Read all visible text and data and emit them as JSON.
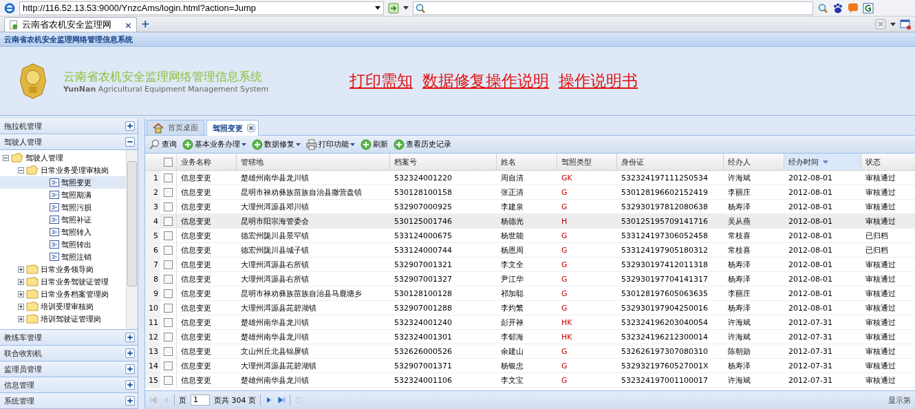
{
  "browser": {
    "address": "http://116.52.13.53:9000/YnzcAms/login.html?action=Jump",
    "tab": {
      "title": "云南省农机安全监理网",
      "close": "×"
    },
    "new_tab": "+"
  },
  "system_bar": {
    "title": "云南省农机安全监理网络管理信息系统"
  },
  "header": {
    "title": "云南省农机安全监理网络管理信息系统",
    "subtitle_bold": "YunNan",
    "subtitle": "Agricultural Equipment Management System",
    "links": [
      "打印需知",
      "数据修复操作说明",
      "操作说明书"
    ]
  },
  "sidebar": {
    "sections": [
      {
        "label": "拖拉机管理",
        "expanded": false
      },
      {
        "label": "驾驶人管理",
        "expanded": true,
        "tree": [
          {
            "label": "驾驶人管理",
            "expanded": true,
            "children": [
              {
                "label": "日常业务受理审核岗",
                "expanded": true,
                "children": [
                  {
                    "label": "驾照变更",
                    "selected": true
                  },
                  {
                    "label": "驾照期满",
                    "selected": false
                  },
                  {
                    "label": "驾照污损",
                    "selected": false
                  },
                  {
                    "label": "驾照补证",
                    "selected": false
                  },
                  {
                    "label": "驾照转入",
                    "selected": false
                  },
                  {
                    "label": "驾照转出",
                    "selected": false
                  },
                  {
                    "label": "驾照注销",
                    "selected": false
                  }
                ]
              },
              {
                "label": "日常业务领导岗",
                "expanded": false
              },
              {
                "label": "日常业务驾驶证管理",
                "expanded": false
              },
              {
                "label": "日常业务档案管理岗",
                "expanded": false
              },
              {
                "label": "培训受理审核岗",
                "expanded": false
              },
              {
                "label": "培训驾驶证管理岗",
                "expanded": false
              }
            ]
          }
        ]
      },
      {
        "label": "教练车管理",
        "expanded": false
      },
      {
        "label": "联合收割机",
        "expanded": false
      },
      {
        "label": "监理员管理",
        "expanded": false
      },
      {
        "label": "信息管理",
        "expanded": false
      },
      {
        "label": "系统管理",
        "expanded": false
      }
    ]
  },
  "tabs": [
    {
      "label": "首页桌面",
      "selected": false,
      "kind": "home"
    },
    {
      "label": "驾照变更",
      "selected": true,
      "kind": "closable"
    }
  ],
  "toolbar": [
    {
      "label": "查询",
      "kind": "search",
      "menu": false
    },
    {
      "label": "基本业务办理",
      "kind": "add",
      "menu": true
    },
    {
      "label": "数据修复",
      "kind": "add",
      "menu": true
    },
    {
      "label": "打印功能",
      "kind": "print",
      "menu": true
    },
    {
      "label": "刷新",
      "kind": "add",
      "menu": false
    },
    {
      "label": "查看历史记录",
      "kind": "add",
      "menu": false
    }
  ],
  "table": {
    "select_all": false,
    "columns": [
      {
        "label": "业务名称",
        "sorted": false
      },
      {
        "label": "管辖地",
        "sorted": false
      },
      {
        "label": "档案号",
        "sorted": false
      },
      {
        "label": "姓名",
        "sorted": false
      },
      {
        "label": "驾照类型",
        "sorted": false
      },
      {
        "label": "身份证",
        "sorted": false
      },
      {
        "label": "经办人",
        "sorted": false
      },
      {
        "label": "经办时间",
        "sorted": true
      },
      {
        "label": "状态",
        "sorted": false
      }
    ],
    "rows": [
      {
        "num": "1",
        "checked": false,
        "selected": false,
        "cells": [
          "信息变更",
          "楚雄州南华县龙川镇",
          "532324001220",
          "周自清",
          "GK",
          "532324197111250534",
          "许海斌",
          "2012-08-01",
          "审核通过"
        ]
      },
      {
        "num": "2",
        "checked": false,
        "selected": false,
        "cells": [
          "信息变更",
          "昆明市禄劝彝族苗族自治县撒营盘镇",
          "530128100158",
          "张正清",
          "G",
          "530128196602152419",
          "李丽庄",
          "2012-08-01",
          "审核通过"
        ]
      },
      {
        "num": "3",
        "checked": false,
        "selected": false,
        "cells": [
          "信息变更",
          "大理州洱源县邓川镇",
          "532907000925",
          "李建泉",
          "G",
          "532930197812080638",
          "杨寿泽",
          "2012-08-01",
          "审核通过"
        ]
      },
      {
        "num": "4",
        "checked": false,
        "selected": true,
        "cells": [
          "信息变更",
          "昆明市阳宗海管委会",
          "530125001746",
          "杨德光",
          "H",
          "530125195709141716",
          "吴从燕",
          "2012-08-01",
          "审核通过"
        ]
      },
      {
        "num": "5",
        "checked": false,
        "selected": false,
        "cells": [
          "信息变更",
          "德宏州陇川县景罕镇",
          "533124000675",
          "杨世能",
          "G",
          "533124197306052458",
          "常枝喜",
          "2012-08-01",
          "已归档"
        ]
      },
      {
        "num": "6",
        "checked": false,
        "selected": false,
        "cells": [
          "信息变更",
          "德宏州陇川县城子镇",
          "533124000744",
          "杨恩周",
          "G",
          "533124197905180312",
          "常枝喜",
          "2012-08-01",
          "已归档"
        ]
      },
      {
        "num": "7",
        "checked": false,
        "selected": false,
        "cells": [
          "信息变更",
          "大理州洱源县右所镇",
          "532907001321",
          "李文全",
          "G",
          "532930197412011318",
          "杨寿泽",
          "2012-08-01",
          "审核通过"
        ]
      },
      {
        "num": "8",
        "checked": false,
        "selected": false,
        "cells": [
          "信息变更",
          "大理州洱源县右所镇",
          "532907001327",
          "尹江华",
          "G",
          "532930197704141317",
          "杨寿泽",
          "2012-08-01",
          "审核通过"
        ]
      },
      {
        "num": "9",
        "checked": false,
        "selected": false,
        "cells": [
          "信息变更",
          "昆明市禄劝彝族苗族自治县马鹿塘乡",
          "530128100128",
          "祁加聪",
          "G",
          "530128197605063635",
          "李丽庄",
          "2012-08-01",
          "审核通过"
        ]
      },
      {
        "num": "10",
        "checked": false,
        "selected": false,
        "cells": [
          "信息变更",
          "大理州洱源县茈碧湖镇",
          "532907001288",
          "李灼繁",
          "G",
          "532930197904250016",
          "杨寿泽",
          "2012-08-01",
          "审核通过"
        ]
      },
      {
        "num": "11",
        "checked": false,
        "selected": false,
        "cells": [
          "信息变更",
          "楚雄州南华县龙川镇",
          "532324001240",
          "彭开禄",
          "HK",
          "532324196203040054",
          "许海斌",
          "2012-07-31",
          "审核通过"
        ]
      },
      {
        "num": "12",
        "checked": false,
        "selected": false,
        "cells": [
          "信息变更",
          "楚雄州南华县龙川镇",
          "532324001301",
          "李郁海",
          "HK",
          "532324196212300014",
          "许海斌",
          "2012-07-31",
          "审核通过"
        ]
      },
      {
        "num": "13",
        "checked": false,
        "selected": false,
        "cells": [
          "信息变更",
          "文山州丘北县锦屏镇",
          "532626000526",
          "余建山",
          "G",
          "532626197307080310",
          "陈朝勋",
          "2012-07-31",
          "审核通过"
        ]
      },
      {
        "num": "14",
        "checked": false,
        "selected": false,
        "cells": [
          "信息变更",
          "大理州洱源县茈碧湖镇",
          "532907001371",
          "杨银忠",
          "G",
          "53293219760527001X",
          "杨寿泽",
          "2012-07-31",
          "审核通过"
        ]
      },
      {
        "num": "15",
        "checked": false,
        "selected": false,
        "cells": [
          "信息变更",
          "楚雄州南华县龙川镇",
          "532324001106",
          "李文宝",
          "G",
          "532324197001100017",
          "许海斌",
          "2012-07-31",
          "审核通过"
        ]
      }
    ]
  },
  "pager": {
    "page_label": "页",
    "page": "1",
    "total": "页共 304 页",
    "info": "显示第"
  }
}
